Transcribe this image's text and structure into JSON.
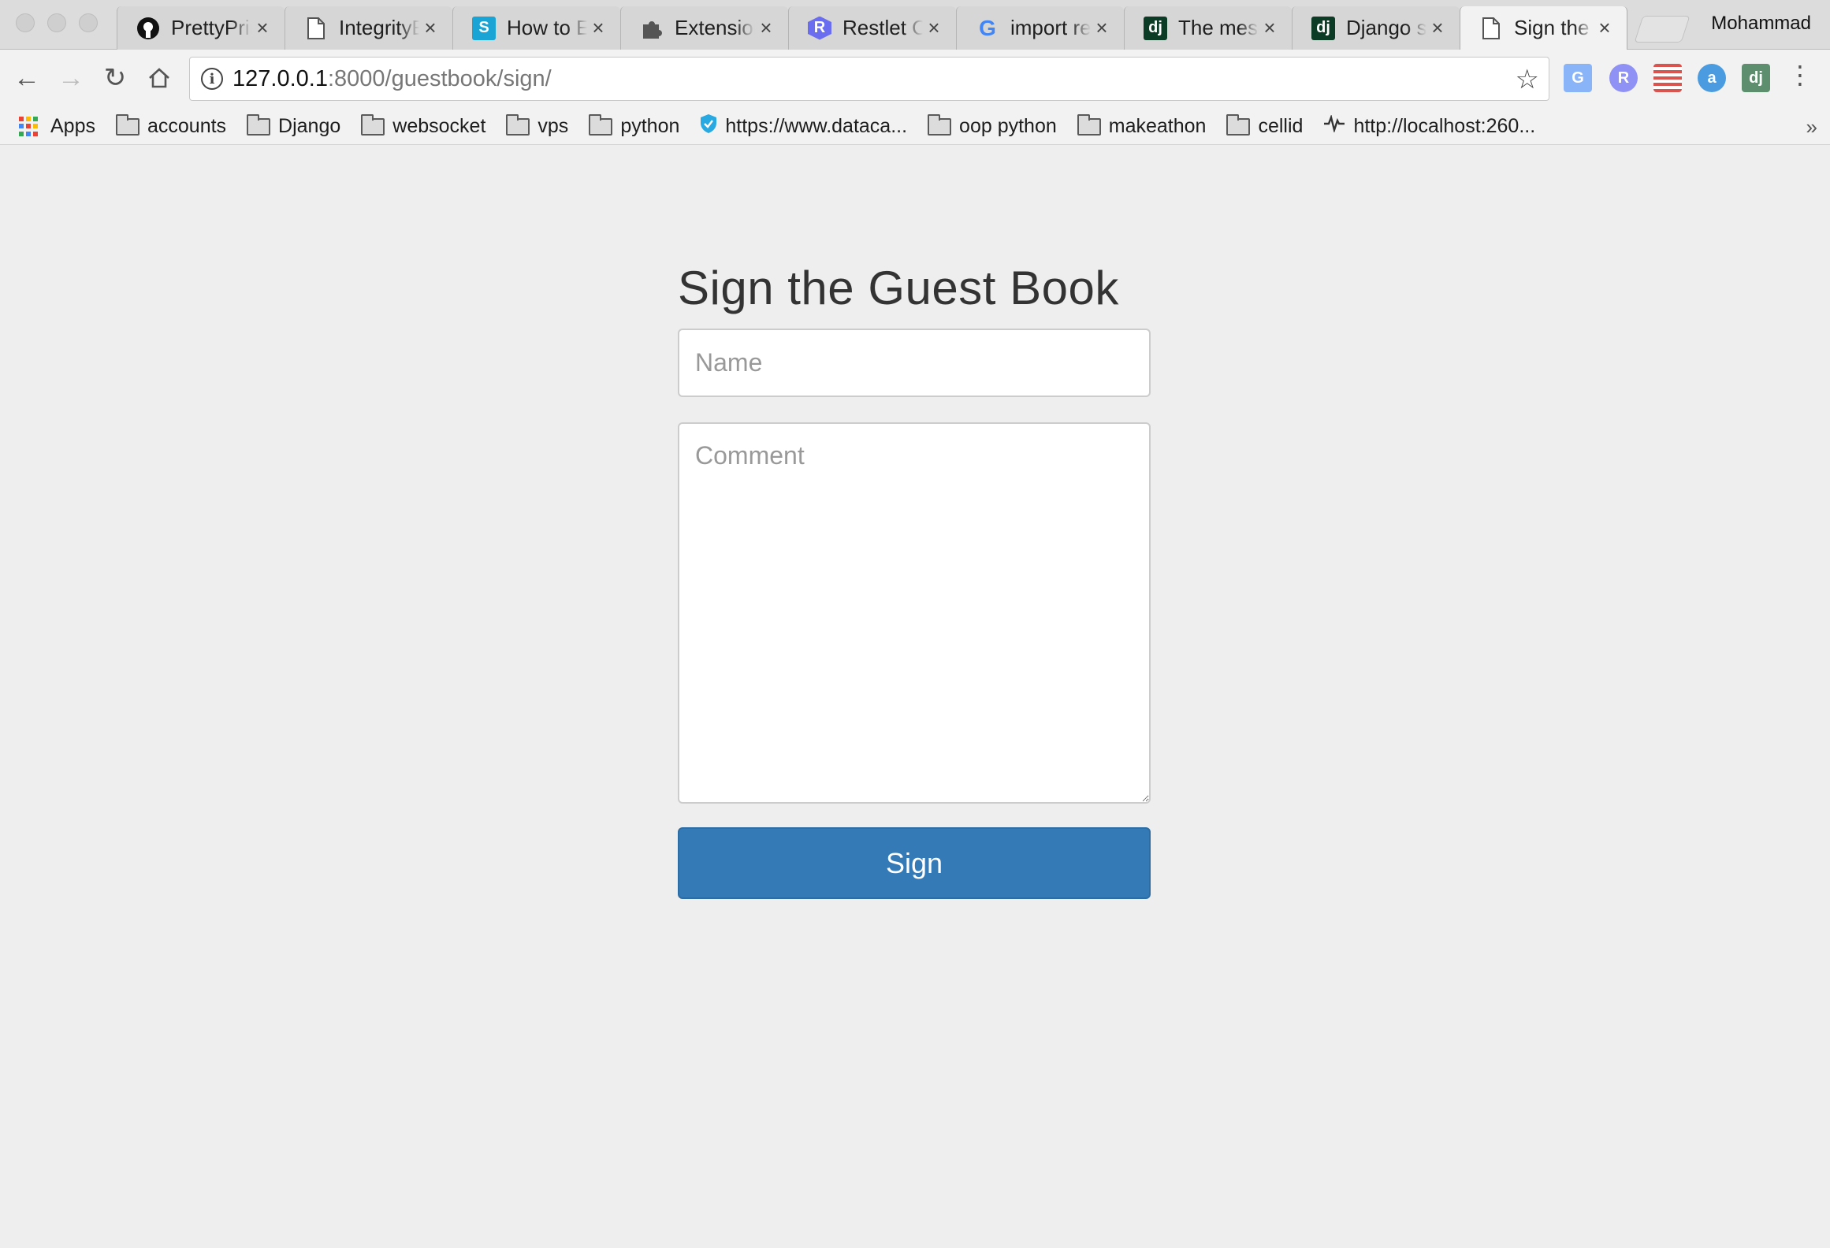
{
  "window": {
    "profile_name": "Mohammad"
  },
  "tabs": [
    {
      "title": "PrettyPrint",
      "icon": "github-icon",
      "icon_color": "#000000",
      "glyph": "",
      "active": false
    },
    {
      "title": "IntegrityError",
      "icon": "document-icon",
      "icon_color": "",
      "glyph": "",
      "active": false
    },
    {
      "title": "How to Edit",
      "icon": "s-logo-icon",
      "icon_color": "#1aa3d5",
      "glyph": "S",
      "active": false
    },
    {
      "title": "Extensions",
      "icon": "puzzle-icon",
      "icon_color": "",
      "glyph": "",
      "active": false
    },
    {
      "title": "Restlet Client",
      "icon": "restlet-icon",
      "icon_color": "#6b6df0",
      "glyph": "R",
      "active": false
    },
    {
      "title": "import re",
      "icon": "google-icon",
      "icon_color": "",
      "glyph": "G",
      "active": false
    },
    {
      "title": "The messages",
      "icon": "django-icon",
      "icon_color": "#0c3c26",
      "glyph": "dj",
      "active": false
    },
    {
      "title": "Django shell",
      "icon": "django-icon",
      "icon_color": "#0c3c26",
      "glyph": "dj",
      "active": false
    },
    {
      "title": "Sign the Guest Book",
      "icon": "document-icon",
      "icon_color": "",
      "glyph": "",
      "active": true
    }
  ],
  "toolbar": {
    "url_host": "127.0.0.1",
    "url_rest": ":8000/guestbook/sign/"
  },
  "bookmarks": [
    {
      "label": "Apps",
      "type": "apps"
    },
    {
      "label": "accounts",
      "type": "folder"
    },
    {
      "label": "Django",
      "type": "folder"
    },
    {
      "label": "websocket",
      "type": "folder"
    },
    {
      "label": "vps",
      "type": "folder"
    },
    {
      "label": "python",
      "type": "folder"
    },
    {
      "label": "https://www.dataca...",
      "type": "shield"
    },
    {
      "label": "oop python",
      "type": "folder"
    },
    {
      "label": "makeathon",
      "type": "folder"
    },
    {
      "label": "cellid",
      "type": "folder"
    },
    {
      "label": "http://localhost:260...",
      "type": "pulse"
    }
  ],
  "page": {
    "title": "Sign the Guest Book",
    "name_placeholder": "Name",
    "comment_placeholder": "Comment",
    "submit_label": "Sign"
  },
  "colors": {
    "primary_button": "#337ab7",
    "page_background": "#eeeeee"
  }
}
